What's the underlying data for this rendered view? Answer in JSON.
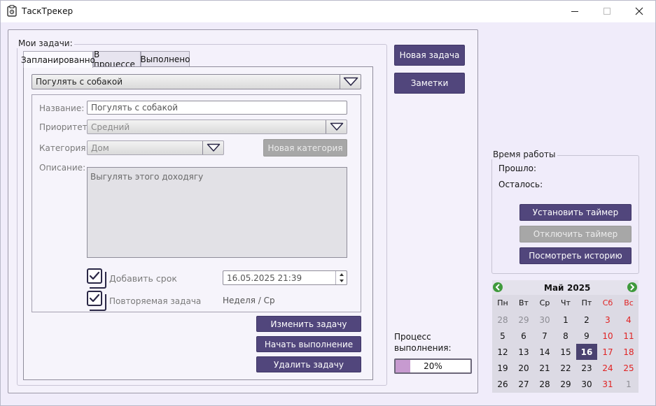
{
  "window": {
    "title": "ТаскТрекер"
  },
  "tasks_group": {
    "title": "Мои задачи:",
    "tabs": [
      {
        "label": "Запланированно",
        "active": true
      },
      {
        "label": "В процессе",
        "active": false
      },
      {
        "label": "Выполнено",
        "active": false
      }
    ],
    "task_select": "Погулять с собакой",
    "form": {
      "name_label": "Название:",
      "name_value": "Погулять с собакой",
      "priority_label": "Приоритет:",
      "priority_value": "Средний",
      "category_label": "Категория:",
      "category_value": "Дом",
      "new_category_button": "Новая категория",
      "description_label": "Описание:",
      "description_value": "Выгулять этого доходягу",
      "deadline_checkbox": "Добавить срок",
      "deadline_checked": true,
      "deadline_value": "16.05.2025 21:39",
      "repeat_checkbox": "Повторяемая задача",
      "repeat_checked": true,
      "repeat_value": "Неделя / Ср"
    },
    "actions": {
      "edit": "Изменить задачу",
      "start": "Начать выполнение",
      "delete": "Удалить задачу"
    }
  },
  "side_buttons": {
    "new_task": "Новая задача",
    "notes": "Заметки"
  },
  "progress": {
    "label_line1": "Процесс",
    "label_line2": "выполнения:",
    "value": 20,
    "text": "20%",
    "fill_color": "#c79ad0"
  },
  "work_time": {
    "title": "Время работы",
    "elapsed_label": "Прошло:",
    "remaining_label": "Осталось:",
    "set_timer": "Установить таймер",
    "disable_timer": "Отключить таймер",
    "view_history": "Посмотреть историю"
  },
  "calendar": {
    "month": "Май",
    "year": "2025",
    "weekdays": [
      "Пн",
      "Вт",
      "Ср",
      "Чт",
      "Пт",
      "Сб",
      "Вс"
    ],
    "weeks": [
      [
        "28",
        "29",
        "30",
        "1",
        "2",
        "3",
        "4"
      ],
      [
        "5",
        "6",
        "7",
        "8",
        "9",
        "10",
        "11"
      ],
      [
        "12",
        "13",
        "14",
        "15",
        "16",
        "17",
        "18"
      ],
      [
        "19",
        "20",
        "21",
        "22",
        "23",
        "24",
        "25"
      ],
      [
        "26",
        "27",
        "28",
        "29",
        "30",
        "31",
        "1"
      ]
    ],
    "selected": "16",
    "accent": "#4a4270"
  },
  "colors": {
    "accent": "#51467c",
    "weekend": "#e02222",
    "background": "#f0ecfa"
  }
}
